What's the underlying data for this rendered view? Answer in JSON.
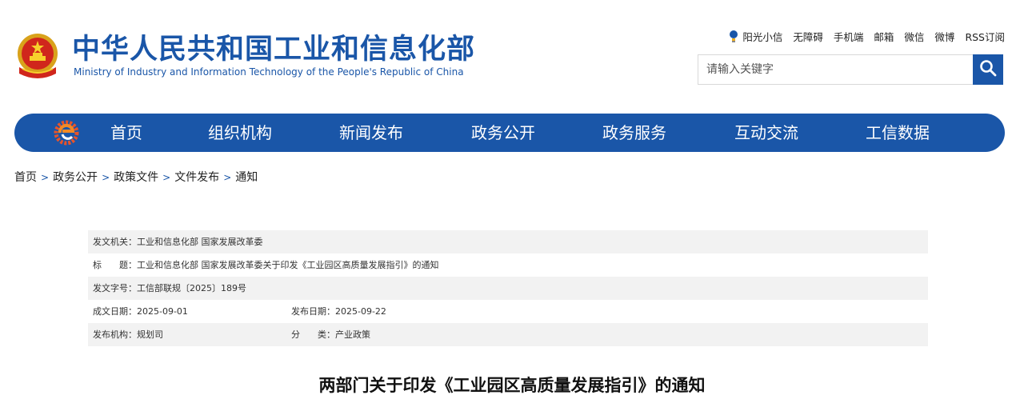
{
  "header": {
    "site_title": "中华人民共和国工业和信息化部",
    "site_subtitle": "Ministry of Industry and Information Technology of the People's Republic of China",
    "emblem_icon": "national-emblem-icon",
    "top_links": [
      "阳光小信",
      "无障碍",
      "手机端",
      "邮箱",
      "微信",
      "微博",
      "RSS订阅"
    ],
    "search": {
      "placeholder": "请输入关键字",
      "icon": "search-icon"
    }
  },
  "nav": {
    "items": [
      "首页",
      "组织机构",
      "新闻发布",
      "政务公开",
      "政务服务",
      "互动交流",
      "工信数据"
    ],
    "color": "#1a56a8"
  },
  "breadcrumb": {
    "items": [
      "首页",
      "政务公开",
      "政策文件",
      "文件发布",
      "通知"
    ],
    "separator": ">"
  },
  "meta": {
    "issuer": "发文机关：工业和信息化部 国家发展改革委",
    "title": "标　　题：工业和信息化部 国家发展改革委关于印发《工业园区高质量发展指引》的通知",
    "doc_number": "发文字号：工信部联规〔2025〕189号",
    "written_date": "成文日期：2025-09-01",
    "publish_date": "发布日期：2025-09-22",
    "publisher": "发布机构：规划司",
    "category": "分　　类：产业政策"
  },
  "article": {
    "title": "两部门关于印发《工业园区高质量发展指引》的通知"
  }
}
